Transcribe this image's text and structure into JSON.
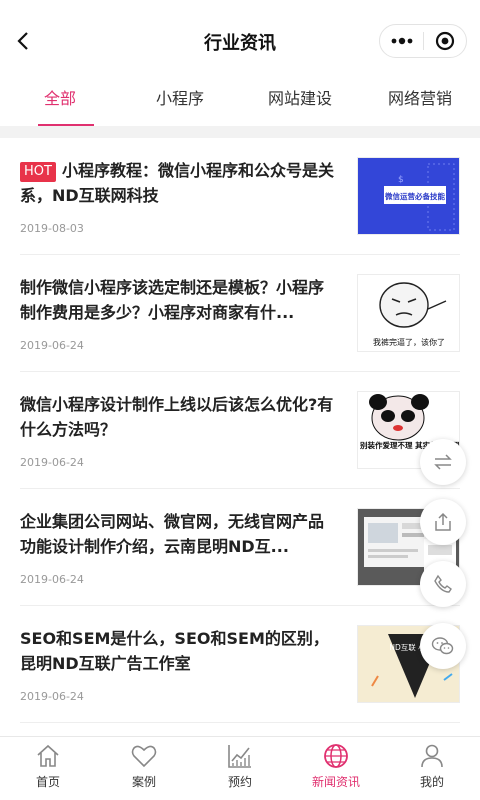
{
  "header": {
    "title": "行业资讯"
  },
  "tabs": [
    {
      "label": "全部"
    },
    {
      "label": "小程序"
    },
    {
      "label": "网站建设"
    },
    {
      "label": "网络营销"
    }
  ],
  "articles": [
    {
      "badge": "HOT",
      "title": "小程序教程：微信小程序和公众号是关系，ND互联网科技",
      "date": "2019-08-03",
      "thumb_text": "微信运营必备技能"
    },
    {
      "title": "制作微信小程序该选定制还是模板？小程序制作费用是多少？小程序对商家有什...",
      "date": "2019-06-24",
      "thumb_text": "我裤完逼了，该你了"
    },
    {
      "title": "微信小程序设计制作上线以后该怎么优化?有什么方法吗？",
      "date": "2019-06-24",
      "thumb_text": "别装作爱理不理 其实你的心里在 是不是"
    },
    {
      "title": "企业集团公司网站、微官网，无线官网产品功能设计制作介绍，云南昆明ND互...",
      "date": "2019-06-24"
    },
    {
      "title": "SEO和SEM是什么，SEO和SEM的区别，昆明ND互联广告工作室",
      "date": "2019-06-24",
      "thumb_text": "ND互联 小程序"
    }
  ],
  "nav": [
    {
      "label": "首页",
      "icon": "home-icon"
    },
    {
      "label": "案例",
      "icon": "heart-icon"
    },
    {
      "label": "预约",
      "icon": "chart-icon"
    },
    {
      "label": "新闻资讯",
      "icon": "globe-icon"
    },
    {
      "label": "我的",
      "icon": "user-icon"
    }
  ],
  "colors": {
    "accent": "#e0306f",
    "hot": "#e8334a",
    "divider": "#eeeeee",
    "muted": "#999999"
  }
}
